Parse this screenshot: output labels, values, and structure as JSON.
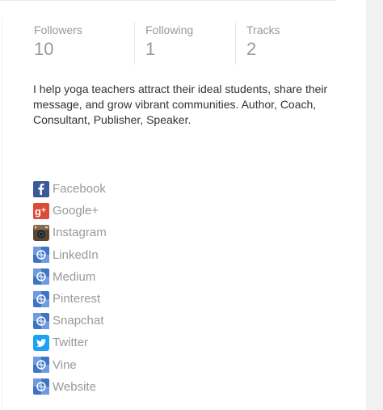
{
  "stats": [
    {
      "label": "Followers",
      "value": "10"
    },
    {
      "label": "Following",
      "value": "1"
    },
    {
      "label": "Tracks",
      "value": "2"
    }
  ],
  "bio": "I help yoga teachers attract their ideal students, share their message, and grow vibrant communities. Author, Coach, Consultant, Publisher, Speaker.",
  "links": [
    {
      "label": "Facebook",
      "icon": "facebook-icon"
    },
    {
      "label": "Google+",
      "icon": "google-plus-icon"
    },
    {
      "label": "Instagram",
      "icon": "instagram-icon"
    },
    {
      "label": "LinkedIn",
      "icon": "generic-link-icon"
    },
    {
      "label": "Medium",
      "icon": "generic-link-icon"
    },
    {
      "label": "Pinterest",
      "icon": "generic-link-icon"
    },
    {
      "label": "Snapchat",
      "icon": "generic-link-icon"
    },
    {
      "label": "Twitter",
      "icon": "twitter-icon"
    },
    {
      "label": "Vine",
      "icon": "generic-link-icon"
    },
    {
      "label": "Website",
      "icon": "generic-link-icon"
    }
  ],
  "colors": {
    "facebook": "#3b5998",
    "google_plus": "#dd4b39",
    "twitter": "#1da1f2",
    "generic": "#3f73c4",
    "muted_text": "#999999",
    "body_text": "#333333"
  }
}
